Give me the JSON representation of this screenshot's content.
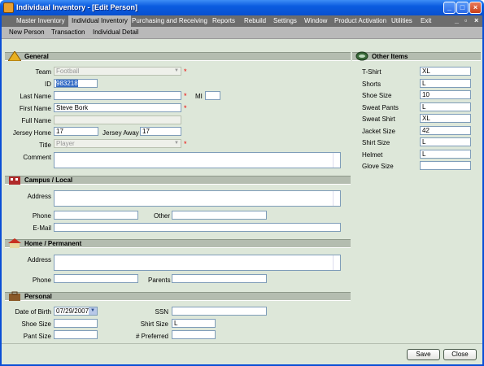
{
  "title": "Individual Inventory - [Edit Person]",
  "window_controls": {
    "minimize": "_",
    "maximize": "□",
    "close": "×"
  },
  "menu": [
    "Master Inventory",
    "Individual Inventory",
    "Purchasing and Receiving",
    "Reports",
    "Rebuild",
    "Settings",
    "Window",
    "Product Activation",
    "Utilities",
    "Exit"
  ],
  "mdi_controls": {
    "minimize": "_",
    "restore": "▫",
    "close": "×"
  },
  "submenu": [
    "New Person",
    "Transaction",
    "Individual Detail"
  ],
  "general": {
    "title": "General",
    "team_label": "Team",
    "team_value": "Football",
    "id_label": "ID",
    "id_value": "983218",
    "last_label": "Last Name",
    "last_value": "",
    "mi_label": "MI",
    "mi_value": "",
    "first_label": "First Name",
    "first_value": "Steve Bork",
    "full_label": "Full Name",
    "full_value": "",
    "jhome_label": "Jersey Home",
    "jhome_value": "17",
    "jaway_label": "Jersey Away",
    "jaway_value": "17",
    "title_label": "Title",
    "title_value": "Player",
    "comment_label": "Comment",
    "comment_value": ""
  },
  "campus": {
    "title": "Campus / Local",
    "address_label": "Address",
    "address_value": "",
    "phone_label": "Phone",
    "phone_value": "",
    "other_label": "Other",
    "other_value": "",
    "email_label": "E-Mail",
    "email_value": ""
  },
  "home": {
    "title": "Home / Permanent",
    "address_label": "Address",
    "address_value": "",
    "phone_label": "Phone",
    "phone_value": "",
    "parents_label": "Parents",
    "parents_value": ""
  },
  "personal": {
    "title": "Personal",
    "dob_label": "Date of Birth",
    "dob_value": "07/29/2007",
    "ssn_label": "SSN",
    "ssn_value": "",
    "shoe_label": "Shoe Size",
    "shoe_value": "",
    "shirt_label": "Shirt Size",
    "shirt_value": "L",
    "pant_label": "Pant Size",
    "pant_value": "",
    "pref_label": "# Preferred",
    "pref_value": ""
  },
  "other": {
    "title": "Other Items",
    "items": [
      {
        "label": "T-Shirt",
        "value": "XL"
      },
      {
        "label": "Shorts",
        "value": "L"
      },
      {
        "label": "Shoe Size",
        "value": "10"
      },
      {
        "label": "Sweat Pants",
        "value": "L"
      },
      {
        "label": "Sweat Shirt",
        "value": "XL"
      },
      {
        "label": "Jacket Size",
        "value": "42"
      },
      {
        "label": "Shirt Size",
        "value": "L"
      },
      {
        "label": "Helmet",
        "value": "L"
      },
      {
        "label": "Glove Size",
        "value": ""
      }
    ]
  },
  "buttons": {
    "save": "Save",
    "close": "Close"
  },
  "required_mark": "*"
}
